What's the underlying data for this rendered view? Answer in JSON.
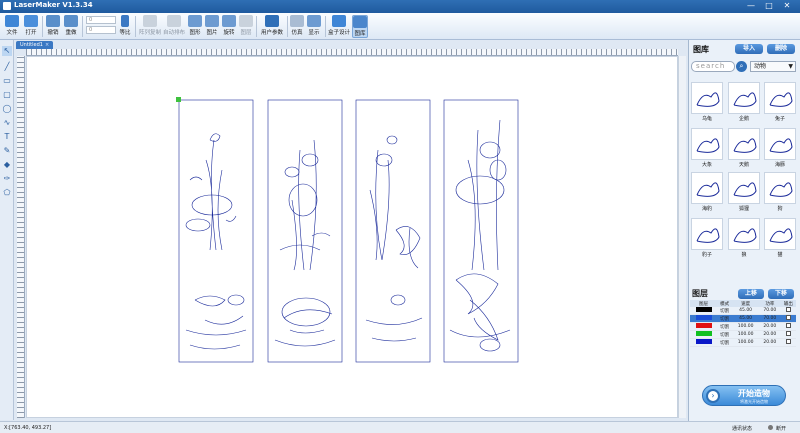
{
  "app": {
    "title": "LaserMaker V1.3.34"
  },
  "window_controls": {
    "minimize": "—",
    "maximize": "□",
    "close": "✕"
  },
  "toolbar": {
    "file": "文件",
    "open": "打开",
    "undo": "撤销",
    "redo": "重做",
    "ratio": "等比",
    "array_copy": "阵列复制",
    "auto_layout": "自动排布",
    "shape": "图形",
    "image": "图片",
    "rotate": "旋转",
    "layer": "图层",
    "user_params": "用户参数",
    "simulate": "仿真",
    "display": "显示",
    "box_design": "盒子设计",
    "gallery": "图库",
    "w_placeholder": "0",
    "h_placeholder": "0",
    "x_placeholder": "0",
    "y_placeholder": "0"
  },
  "document": {
    "tab": "Untitled1",
    "tab_close": "×"
  },
  "library": {
    "title": "图库",
    "import": "导入",
    "delete": "删除",
    "search_placeholder": "search",
    "category": "动物",
    "items": [
      {
        "name": "乌龟",
        "icon": "turtle-icon"
      },
      {
        "name": "企鹅",
        "icon": "penguin-icon"
      },
      {
        "name": "兔子",
        "icon": "rabbit-icon"
      },
      {
        "name": "大象",
        "icon": "elephant-icon"
      },
      {
        "name": "天鹅",
        "icon": "swan-icon"
      },
      {
        "name": "海豚",
        "icon": "dolphin-icon"
      },
      {
        "name": "海豹",
        "icon": "seal-icon"
      },
      {
        "name": "狐狸",
        "icon": "fox-icon"
      },
      {
        "name": "狗",
        "icon": "dog-icon"
      },
      {
        "name": "豹子",
        "icon": "leopard-icon"
      },
      {
        "name": "狼",
        "icon": "wolf-icon"
      },
      {
        "name": "猫",
        "icon": "cat-icon"
      }
    ]
  },
  "layers": {
    "title": "图层",
    "up": "上移",
    "down": "下移",
    "headers": [
      "图层",
      "模式",
      "速度",
      "功率",
      "输出"
    ],
    "rows": [
      {
        "color": "#000000",
        "mode": "切割",
        "speed": "45.00",
        "power": "70.00",
        "selected": false
      },
      {
        "color": "#1a4fd6",
        "mode": "切割",
        "speed": "45.00",
        "power": "70.00",
        "selected": true
      },
      {
        "color": "#e01010",
        "mode": "切割",
        "speed": "100.00",
        "power": "20.00",
        "selected": false
      },
      {
        "color": "#10c020",
        "mode": "切割",
        "speed": "100.00",
        "power": "20.00",
        "selected": false
      },
      {
        "color": "#0a18c8",
        "mode": "切割",
        "speed": "100.00",
        "power": "20.00",
        "selected": false
      }
    ]
  },
  "start_button": {
    "label": "开始造物",
    "sub": "将激光开始造物"
  },
  "status": {
    "coords": "X:[763.40, 493.27]",
    "connection": "通讯状态",
    "disconnected": "断开"
  }
}
